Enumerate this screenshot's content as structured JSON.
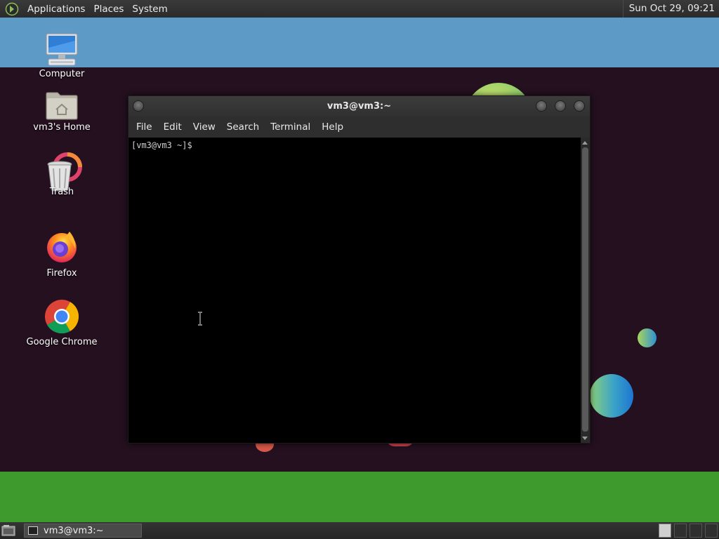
{
  "top_panel": {
    "menus": [
      "Applications",
      "Places",
      "System"
    ],
    "clock": "Sun Oct 29, 09:21",
    "logo_icon": "gnome-foot-icon"
  },
  "desktop_icons": [
    {
      "label": "Computer",
      "icon": "computer-icon"
    },
    {
      "label": "vm3's Home",
      "icon": "home-folder-icon"
    },
    {
      "label": "Trash",
      "icon": "trash-icon"
    },
    {
      "label": "Firefox",
      "icon": "firefox-icon"
    },
    {
      "label": "Google Chrome",
      "icon": "chrome-icon"
    }
  ],
  "terminal": {
    "title": "vm3@vm3:~",
    "menus": [
      "File",
      "Edit",
      "View",
      "Search",
      "Terminal",
      "Help"
    ],
    "prompt": "[vm3@vm3 ~]$"
  },
  "bottom_panel": {
    "task_label": "vm3@vm3:~"
  },
  "colors": {
    "sky": "#5d9bc6",
    "desktop_dark": "#24101f",
    "grass": "#3e9a2d",
    "panel": "#2b2b2b",
    "terminal_bg": "#000000"
  }
}
